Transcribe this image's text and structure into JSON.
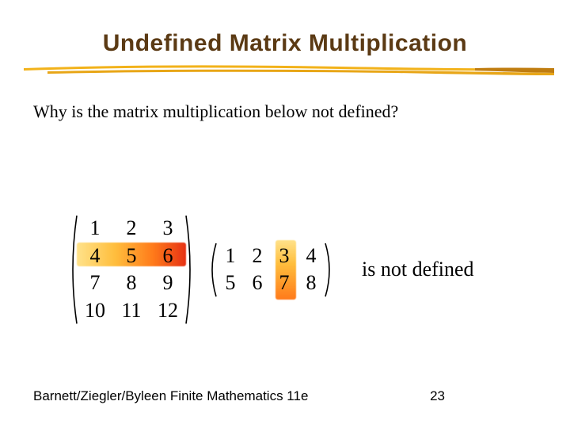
{
  "title": "Undefined Matrix Multiplication",
  "question": "Why is the matrix multiplication below not defined?",
  "matrix_a": {
    "rows": 4,
    "cols": 3,
    "cells": [
      "1",
      "2",
      "3",
      "4",
      "5",
      "6",
      "7",
      "8",
      "9",
      "10",
      "11",
      "12"
    ],
    "highlight_row": 2
  },
  "matrix_b": {
    "rows": 2,
    "cols": 4,
    "cells": [
      "1",
      "2",
      "3",
      "4",
      "5",
      "6",
      "7",
      "8"
    ],
    "highlight_col": 3
  },
  "status_text": "is not defined",
  "footer_text": "Barnett/Ziegler/Byleen Finite Mathematics 11e",
  "page_number": "23"
}
